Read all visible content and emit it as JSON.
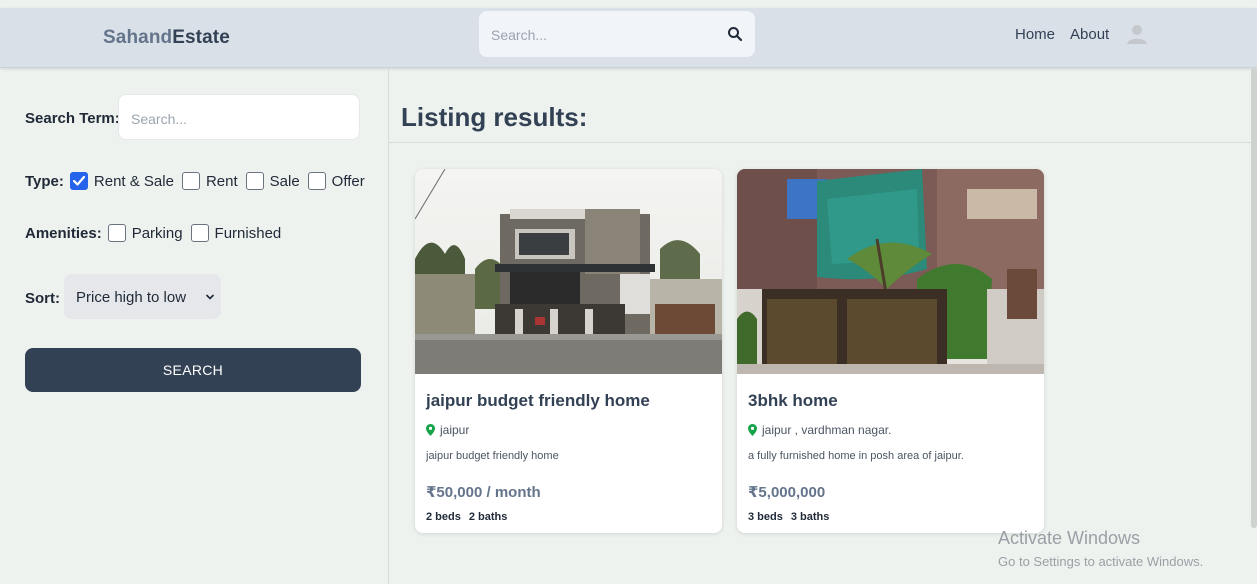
{
  "header": {
    "logo_part1": "Sahand",
    "logo_part2": "Estate",
    "search_placeholder": "Search...",
    "nav": {
      "home": "Home",
      "about": "About"
    }
  },
  "filters": {
    "search_term_label": "Search Term:",
    "search_term_placeholder": "Search...",
    "type_label": "Type:",
    "type_options": [
      {
        "label": "Rent & Sale",
        "checked": true
      },
      {
        "label": "Rent",
        "checked": false
      },
      {
        "label": "Sale",
        "checked": false
      },
      {
        "label": "Offer",
        "checked": false
      }
    ],
    "amenities_label": "Amenities:",
    "amenity_options": [
      {
        "label": "Parking",
        "checked": false
      },
      {
        "label": "Furnished",
        "checked": false
      }
    ],
    "sort_label": "Sort:",
    "sort_value": "Price high to low",
    "search_button": "SEARCH"
  },
  "results": {
    "title": "Listing results:",
    "listings": [
      {
        "title": "jaipur budget friendly home",
        "location": "jaipur",
        "description": "jaipur budget friendly home",
        "price": "₹50,000 / month",
        "beds": "2 beds",
        "baths": "2 baths"
      },
      {
        "title": "3bhk home",
        "location": "jaipur , vardhman nagar.",
        "description": "a fully furnished home in posh area of jaipur.",
        "price": "₹5,000,000",
        "beds": "3 beds",
        "baths": "3 baths"
      }
    ]
  },
  "watermark": {
    "line1": "Activate Windows",
    "line2": "Go to Settings to activate Windows."
  },
  "colors": {
    "primary": "#334155",
    "accent_checkbox": "#2563eb",
    "header_bg": "#d9e0e8",
    "page_bg": "#eef2ee"
  }
}
